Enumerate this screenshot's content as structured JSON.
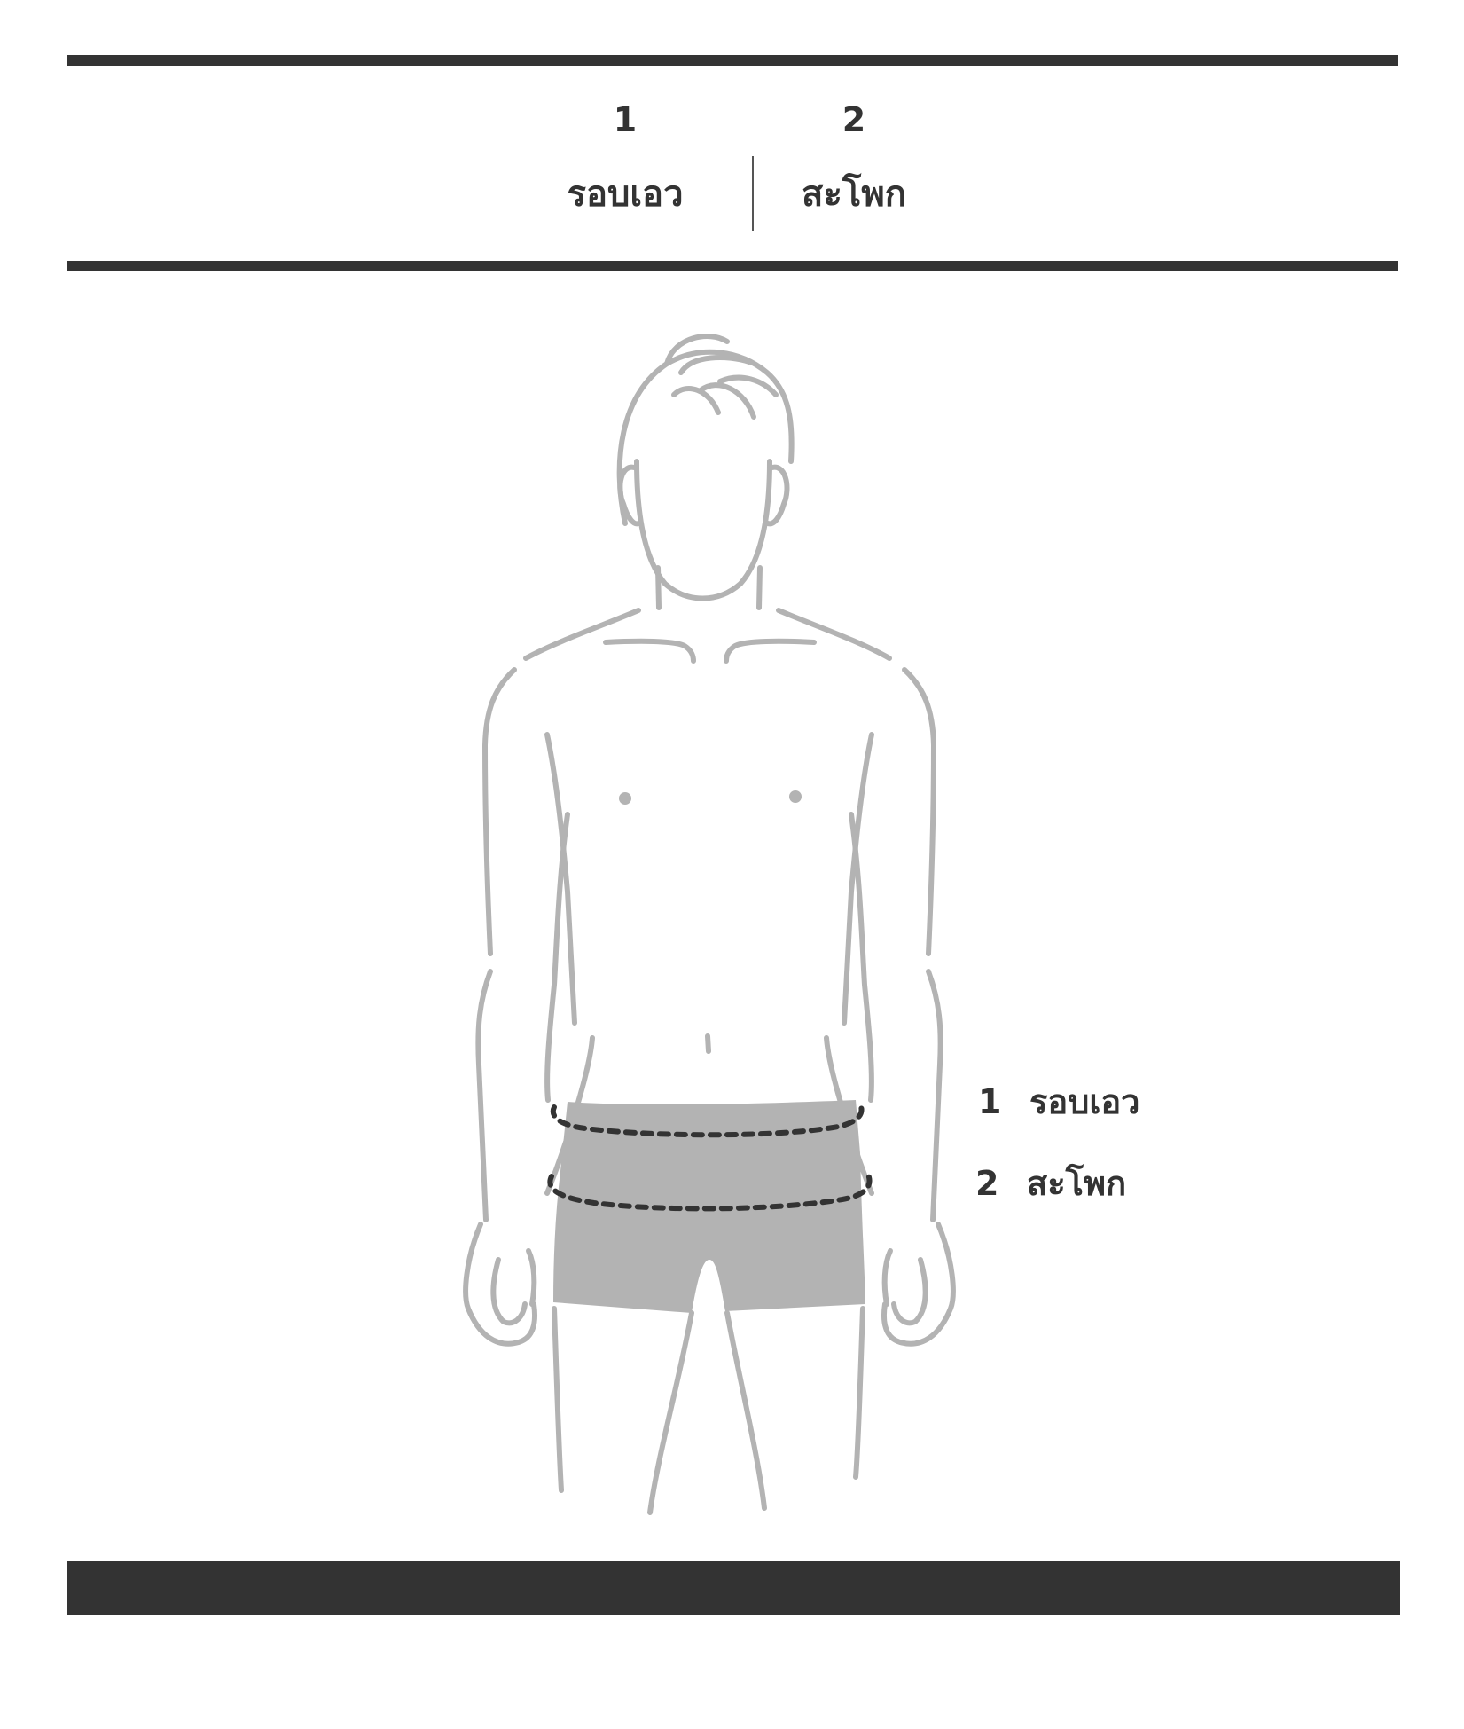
{
  "header": {
    "columns": [
      {
        "number": "1",
        "label": "รอบเอว"
      },
      {
        "number": "2",
        "label": "สะโพก"
      }
    ]
  },
  "legend": [
    {
      "number": "1",
      "label": "รอบเอว"
    },
    {
      "number": "2",
      "label": "สะโพก"
    }
  ],
  "colors": {
    "rule": "#333333",
    "outline": "#b3b3b3",
    "shorts_fill": "#b3b3b3",
    "measure_line": "#333333"
  }
}
